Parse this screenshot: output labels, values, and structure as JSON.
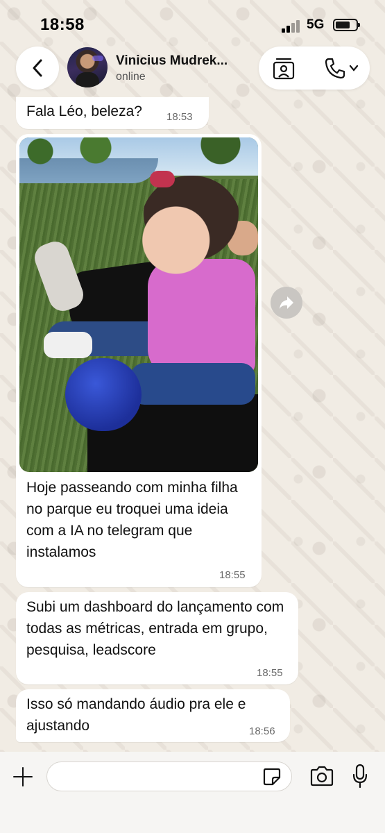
{
  "status_bar": {
    "time": "18:58",
    "network": "5G",
    "signal_icon": "signal-bars-icon",
    "battery_icon": "battery-icon"
  },
  "header": {
    "back_icon": "chevron-left-icon",
    "contact_name": "Vinicius Mudrek...",
    "contact_status": "online",
    "video_icon": "video-call-icon",
    "call_icon": "phone-icon"
  },
  "messages": [
    {
      "text": "Fala Léo, beleza?",
      "time": "18:53"
    },
    {
      "text": "Hoje passeando com minha filha no parque eu troquei uma ideia com a IA no telegram que instalamos",
      "time": "18:55",
      "has_photo": true
    },
    {
      "text": "Subi um dashboard do lançamento com todas as métricas, entrada em grupo, pesquisa, leadscore",
      "time": "18:55"
    },
    {
      "text": "Isso só mandando áudio pra ele e ajustando",
      "time": "18:56"
    }
  ],
  "composer": {
    "placeholder": "",
    "add_icon": "plus-icon",
    "sticker_icon": "sticker-icon",
    "camera_icon": "camera-icon",
    "mic_icon": "microphone-icon"
  },
  "colors": {
    "wallpaper": "#f1ece4",
    "bubble": "#ffffff",
    "timestamp": "#6b6b6b"
  }
}
